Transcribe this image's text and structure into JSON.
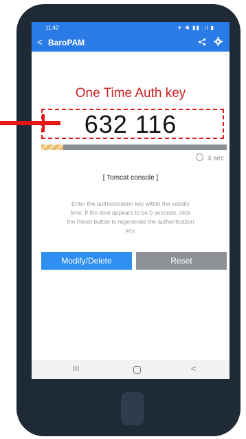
{
  "status_bar": {
    "time": "11:42",
    "indicators": "✈ ✱ ▮▮ .ıl ▮"
  },
  "app_bar": {
    "back_glyph": "<",
    "title": "BaroPAM",
    "share_glyph": "⋖",
    "settings_glyph": "✿"
  },
  "auth": {
    "title": "One Time Auth key",
    "key": "632 116",
    "remaining_fraction": 0.12,
    "timer_text": "4 sec",
    "service_label": "[ Tomcat console ]",
    "instructions": "Enter the authentication key within the validity time. If the time appears to be 0 seconds, click the Reset button to regenerate the authentication key."
  },
  "buttons": {
    "modify": "Modify/Delete",
    "reset": "Reset"
  },
  "nav_bar": {
    "recents": "III",
    "back": "<"
  },
  "colors": {
    "accent": "#2b7be7",
    "title_red": "#cc1f1f",
    "highlight": "#e21818",
    "reset_gray": "#8e9196"
  }
}
